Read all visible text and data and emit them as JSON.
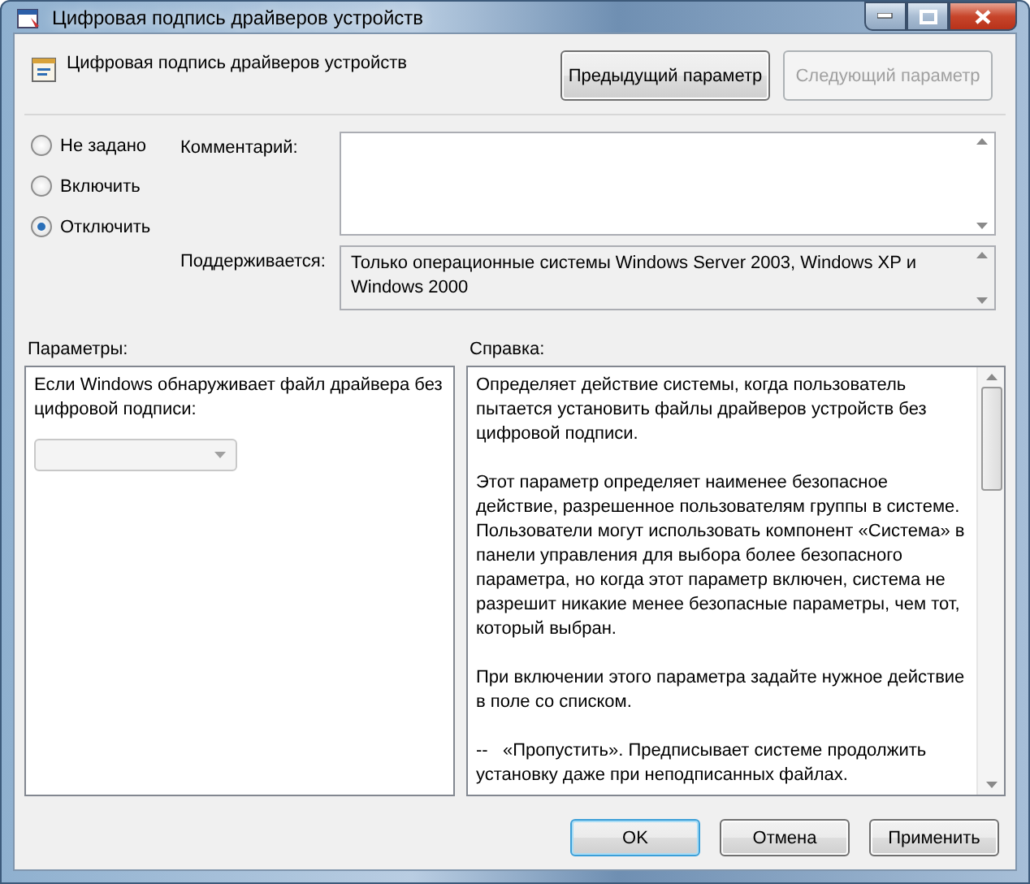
{
  "window": {
    "title": "Цифровая подпись драйверов устройств"
  },
  "header": {
    "title": "Цифровая подпись драйверов устройств"
  },
  "nav_buttons": [
    {
      "label": "Предыдущий параметр",
      "disabled": false
    },
    {
      "label": "Следующий параметр",
      "disabled": true
    }
  ],
  "state_options": [
    {
      "label": "Не задано",
      "selected": false
    },
    {
      "label": "Включить",
      "selected": false
    },
    {
      "label": "Отключить",
      "selected": true
    }
  ],
  "comment": {
    "label": "Комментарий:"
  },
  "supported": {
    "label": "Поддерживается:",
    "value": "Только операционные системы Windows Server 2003, Windows XP и Windows 2000"
  },
  "options": {
    "label": "Параметры:",
    "text": "Если Windows обнаруживает файл драйвера без цифровой подписи:",
    "dropdown": {
      "disabled": true
    }
  },
  "help": {
    "label": "Справка:",
    "paragraphs": [
      "Определяет действие системы, когда пользователь пытается установить файлы драйверов устройств без цифровой подписи.",
      "Этот параметр определяет наименее безопасное действие, разрешенное пользователям группы в системе. Пользователи могут использовать компонент «Система» в панели управления для выбора более безопасного параметра, но когда этот параметр включен, система не разрешит никакие менее безопасные параметры, чем тот, который выбран.",
      "При включении этого параметра задайте нужное действие в поле со списком.",
      "--   «Пропустить». Предписывает системе продолжить установку даже при неподписанных файлах."
    ]
  },
  "buttons": [
    {
      "label": "OK",
      "default": true
    },
    {
      "label": "Отмена",
      "default": false
    },
    {
      "label": "Применить",
      "default": false
    }
  ]
}
